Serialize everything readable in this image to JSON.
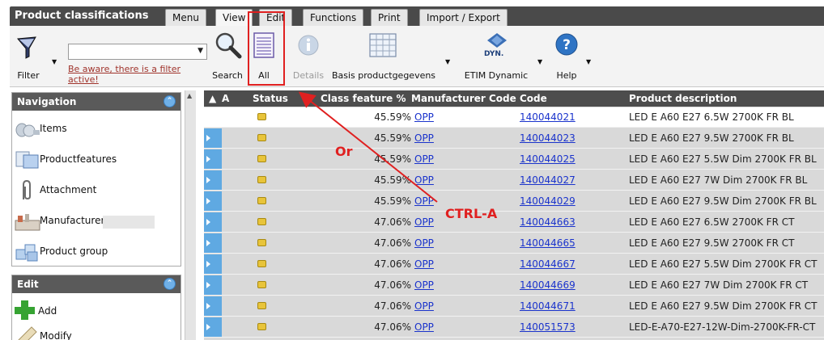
{
  "app": {
    "title": "Product classifications",
    "tabs": [
      {
        "label": "Menu",
        "active": false
      },
      {
        "label": "View",
        "active": true
      },
      {
        "label": "Edit",
        "active": false
      },
      {
        "label": "Functions",
        "active": false
      },
      {
        "label": "Print",
        "active": false
      },
      {
        "label": "Import / Export",
        "active": false
      }
    ]
  },
  "toolbar": {
    "filter_label": "Filter",
    "filter_value": "",
    "filter_warning": "Be aware, there is a filter active!",
    "search_label": "Search",
    "all_label": "All",
    "details_label": "Details",
    "basis_label": "Basis productgegevens",
    "etim_label": "ETIM Dynamic",
    "etim_logo_text": "DYN.",
    "help_label": "Help"
  },
  "navigation": {
    "title": "Navigation",
    "items": [
      {
        "label": "Items",
        "icon": "items-icon"
      },
      {
        "label": "Productfeatures",
        "icon": "productfeatures-icon"
      },
      {
        "label": "Attachment",
        "icon": "paperclip-icon"
      },
      {
        "label": "Manufacturer",
        "icon": "manufacturer-icon"
      },
      {
        "label": "Product group",
        "icon": "cubes-icon"
      }
    ]
  },
  "edit_panel": {
    "title": "Edit",
    "items": [
      {
        "label": "Add",
        "icon": "plus-icon"
      },
      {
        "label": "Modify",
        "icon": "pencil-icon"
      }
    ]
  },
  "grid": {
    "sort_label": "A",
    "columns": [
      "Status",
      "Class feature %",
      "Manufacturer Code",
      "Code",
      "Product description"
    ],
    "rows": [
      {
        "pct": "45.59%",
        "mfr": "OPP",
        "code": "140044021",
        "desc": "LED E A60 E27 6.5W 2700K FR BL"
      },
      {
        "pct": "45.59%",
        "mfr": "OPP",
        "code": "140044023",
        "desc": "LED E A60 E27 9.5W 2700K FR BL"
      },
      {
        "pct": "45.59%",
        "mfr": "OPP",
        "code": "140044025",
        "desc": "LED E A60 E27 5.5W Dim 2700K FR BL"
      },
      {
        "pct": "45.59%",
        "mfr": "OPP",
        "code": "140044027",
        "desc": "LED E A60 E27 7W Dim 2700K FR BL"
      },
      {
        "pct": "45.59%",
        "mfr": "OPP",
        "code": "140044029",
        "desc": "LED E A60 E27 9.5W Dim 2700K FR BL"
      },
      {
        "pct": "47.06%",
        "mfr": "OPP",
        "code": "140044663",
        "desc": "LED E A60 E27 6.5W 2700K FR CT"
      },
      {
        "pct": "47.06%",
        "mfr": "OPP",
        "code": "140044665",
        "desc": "LED E A60 E27 9.5W 2700K FR CT"
      },
      {
        "pct": "47.06%",
        "mfr": "OPP",
        "code": "140044667",
        "desc": "LED E A60 E27 5.5W Dim 2700K FR CT"
      },
      {
        "pct": "47.06%",
        "mfr": "OPP",
        "code": "140044669",
        "desc": "LED E A60 E27 7W Dim 2700K FR CT"
      },
      {
        "pct": "47.06%",
        "mfr": "OPP",
        "code": "140044671",
        "desc": "LED E A60 E27 9.5W Dim 2700K FR CT"
      },
      {
        "pct": "47.06%",
        "mfr": "OPP",
        "code": "140051573",
        "desc": "LED-E-A70-E27-12W-Dim-2700K-FR-CT"
      }
    ]
  },
  "annotations": {
    "or_text": "Or",
    "shortcut_text": "CTRL-A",
    "color": "#e02020"
  },
  "colors": {
    "header_bg": "#4a4a4a",
    "link": "#1a33cc",
    "warning": "#a0342c",
    "row_selector": "#5fa9e2",
    "status_badge": "#e8c43a"
  }
}
